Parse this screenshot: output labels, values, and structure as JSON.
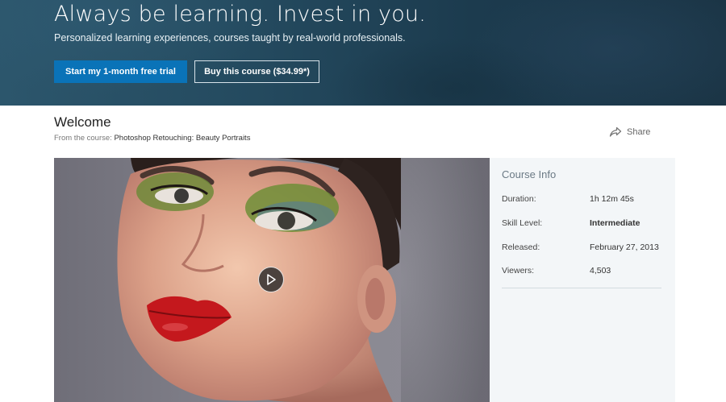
{
  "hero": {
    "title": "Always be learning. Invest in you.",
    "subtitle": "Personalized learning experiences, courses taught by real-world professionals.",
    "trial_button": "Start my 1-month free trial",
    "buy_button": "Buy this course ($34.99*)"
  },
  "header": {
    "title": "Welcome",
    "from_prefix": "From the course:",
    "course_name": "Photoshop Retouching: Beauty Portraits",
    "share_label": "Share"
  },
  "video": {
    "thumbnail": "portrait-thumbnail",
    "play_icon": "play-icon"
  },
  "course_info": {
    "title": "Course Info",
    "rows": [
      {
        "label": "Duration:",
        "value": "1h 12m 45s"
      },
      {
        "label": "Skill Level:",
        "value": "Intermediate"
      },
      {
        "label": "Released:",
        "value": "February 27, 2013"
      },
      {
        "label": "Viewers:",
        "value": "4,503"
      }
    ]
  },
  "colors": {
    "accent": "#0a73b8",
    "hero_bg": "#244a5f",
    "panel_bg": "#f3f6f8"
  }
}
